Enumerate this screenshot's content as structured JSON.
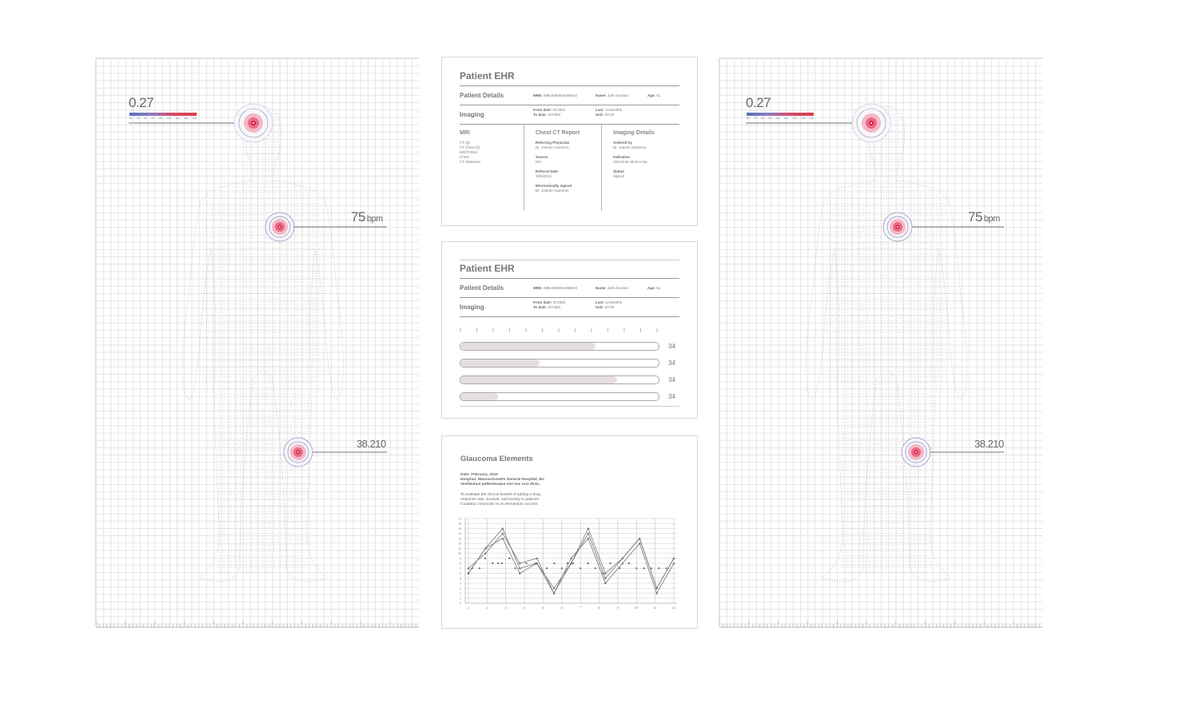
{
  "body_panels": [
    {
      "id": "left",
      "head_value": "0.27",
      "heart_value": "75",
      "heart_unit": "bpm",
      "knee_value": "38.210",
      "scale_ticks": [
        "60",
        "70",
        "80",
        "90",
        "100",
        "110",
        "120",
        "130",
        "140"
      ]
    },
    {
      "id": "right",
      "head_value": "0.27",
      "heart_value": "75",
      "heart_unit": "bpm",
      "knee_value": "38.210",
      "scale_ticks": [
        "60",
        "70",
        "80",
        "90",
        "100",
        "110",
        "120",
        "130",
        "140"
      ]
    }
  ],
  "card1": {
    "title": "Patient EHR",
    "patient_details_label": "Patient Details",
    "mrn_label": "MRN:",
    "mrn_value": "0d8c0306b1e0584c0",
    "name_label": "Name:",
    "name_value": "John Durand",
    "age_label": "Age:",
    "age_value": "61",
    "imaging_label": "Imaging",
    "from_label": "From date:",
    "from_value": "3/Y30/d",
    "to_label": "To date:",
    "to_value": "3/Y30/d",
    "last_label": "Last:",
    "last_value": "12 Months",
    "unit_label": "Unit:",
    "unit_value": "3/Y30",
    "mri_title": "MRI",
    "mri_items": [
      "CT (3)",
      "CT Chest (2)",
      "02/07/2012",
      "Chest",
      "CT Abdomen"
    ],
    "ct_title": "Chest CT Report",
    "ct_fields": [
      {
        "label": "Referring Physician",
        "value": "Dr. Joanne Cameron"
      },
      {
        "label": "Source",
        "value": "N/A"
      },
      {
        "label": "Referral Date",
        "value": "3/05/2012"
      },
      {
        "label": "Electronically signed",
        "value": "Dr. Joanne Cameron"
      }
    ],
    "img_title": "Imaging Details",
    "img_fields": [
      {
        "label": "Ordered by",
        "value": "Dr. Joanne Cameron"
      },
      {
        "label": "Indication",
        "value": "Abnormal chest x-ray"
      },
      {
        "label": "Status",
        "value": "Signed"
      }
    ]
  },
  "card2": {
    "title": "Patient EHR",
    "patient_details_label": "Patient Details",
    "mrn_label": "MRN:",
    "mrn_value": "0d8c0306b1e0584c0",
    "name_label": "Name:",
    "name_value": "John Durand",
    "age_label": "Age:",
    "age_value": "61",
    "imaging_label": "Imaging",
    "from_label": "From date:",
    "from_value": "3/Y30/d",
    "to_label": "To date:",
    "to_value": "3/Y30/d",
    "last_label": "Last:",
    "last_value": "12 Months",
    "unit_label": "Unit:",
    "unit_value": "3/Y30",
    "bars": [
      {
        "fill": 0.68,
        "value": "34"
      },
      {
        "fill": 0.4,
        "value": "34"
      },
      {
        "fill": 0.79,
        "value": "34"
      },
      {
        "fill": 0.19,
        "value": "34"
      }
    ]
  },
  "card3": {
    "title": "Glaucoma Elements",
    "date_line": "Date: February, 2015",
    "hospital_line": "Hospital: Massachusetts General Hospital, Bo",
    "lorem_line": "Vestibulum pellentesque nisl nec orci dictu.",
    "desc_lines": [
      "To evaluate the clinical benefit of adding a drug",
      "response rate, survival, and toxicity in patients",
      "Curabitur commodo ex et elementum accums"
    ]
  },
  "chart_data": {
    "type": "line",
    "x": [
      1,
      2,
      3,
      4,
      5,
      6,
      7,
      8,
      9,
      10,
      11,
      12
    ],
    "y_ticks": [
      "0",
      "1",
      "2",
      "3",
      "4",
      "5",
      "6",
      "7",
      "8",
      "9",
      "10",
      "11",
      "12",
      "13",
      "14",
      "15",
      "16",
      "17"
    ],
    "ylim": [
      0,
      17
    ],
    "grid": true,
    "series": [
      {
        "values": [
          6,
          11,
          13,
          6,
          8,
          3,
          8,
          14,
          5,
          9,
          13,
          3,
          9
        ]
      },
      {
        "values": [
          7,
          10,
          14,
          8,
          9,
          2,
          9,
          13,
          4,
          8,
          12,
          2,
          8
        ]
      },
      {
        "values": [
          6,
          11,
          15,
          7,
          8,
          2,
          8,
          15,
          6,
          9,
          13,
          3,
          9
        ]
      }
    ],
    "scatter": [
      [
        1.2,
        7
      ],
      [
        1.6,
        7
      ],
      [
        1.9,
        9
      ],
      [
        2.3,
        8
      ],
      [
        2.6,
        8
      ],
      [
        2.8,
        8
      ],
      [
        3.2,
        9
      ],
      [
        3.5,
        7
      ],
      [
        4.1,
        8
      ],
      [
        4.6,
        8
      ],
      [
        5.2,
        7
      ],
      [
        5.6,
        8
      ],
      [
        6,
        7
      ],
      [
        6.3,
        8
      ],
      [
        6.6,
        8
      ],
      [
        7.0,
        7
      ],
      [
        7.4,
        8
      ],
      [
        7.8,
        7
      ],
      [
        8.2,
        6
      ],
      [
        8.6,
        8
      ],
      [
        9.1,
        7
      ],
      [
        9.6,
        8
      ],
      [
        10.0,
        7
      ],
      [
        10.4,
        7
      ],
      [
        10.8,
        7
      ],
      [
        11.2,
        7
      ],
      [
        11.6,
        7
      ]
    ],
    "x_ticks": [
      "1",
      "2",
      "3",
      "4",
      "5",
      "6",
      "7",
      "8",
      "9",
      "10",
      "11",
      "12"
    ]
  }
}
